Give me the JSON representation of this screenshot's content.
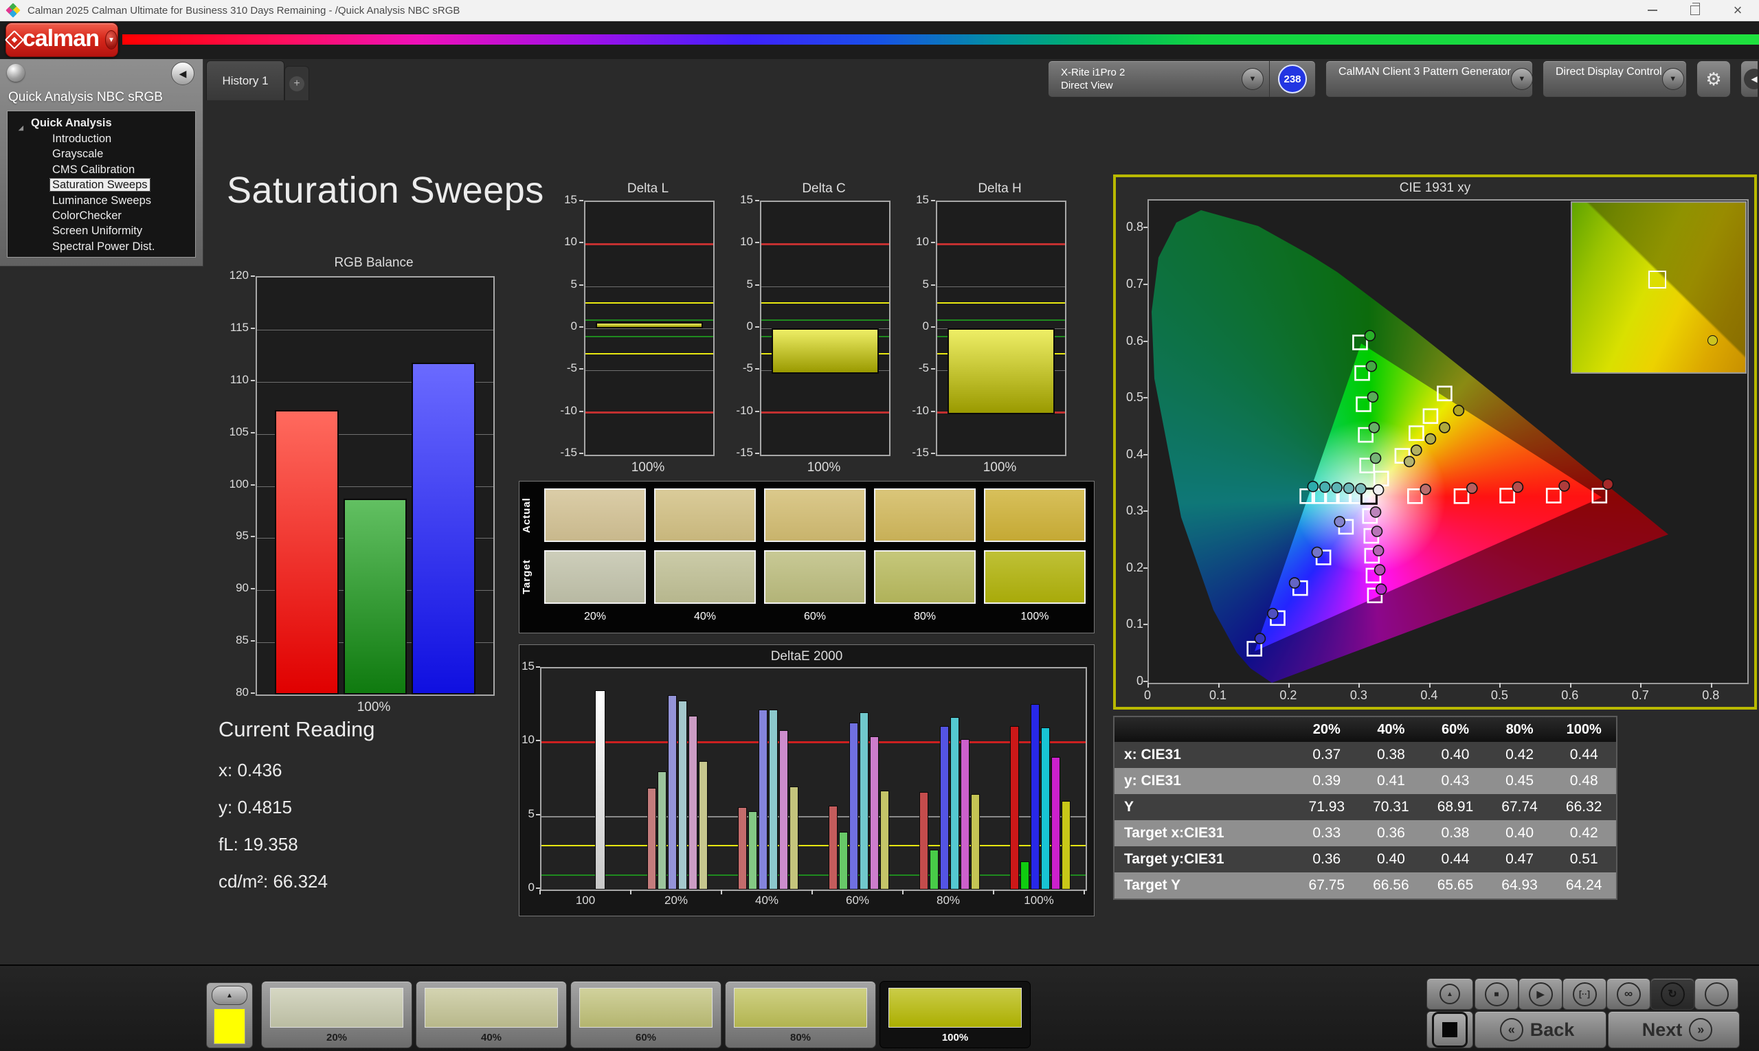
{
  "window": {
    "title": "Calman 2025 Calman Ultimate for Business 310 Days Remaining  - /Quick Analysis NBC sRGB"
  },
  "tabs": {
    "history": "History 1",
    "add": "+"
  },
  "toolbar": {
    "meter": {
      "line1": "X-Rite i1Pro 2",
      "line2": "Direct View",
      "badge": "238",
      "accent": "#27c627"
    },
    "pattern": {
      "label": "CalMAN Client 3 Pattern Generator",
      "accent": "#27c627"
    },
    "display": {
      "label": "Direct Display Control",
      "accent": "#e6e600"
    }
  },
  "header": {
    "logo_text": "calman"
  },
  "sidebar": {
    "title": "Quick Analysis NBC sRGB",
    "root": "Quick Analysis",
    "items": [
      "Introduction",
      "Grayscale",
      "CMS Calibration",
      "Saturation Sweeps",
      "Luminance Sweeps",
      "ColorChecker",
      "Screen Uniformity",
      "Spectral Power Dist."
    ],
    "selected": "Saturation Sweeps"
  },
  "page": {
    "title": "Saturation Sweeps"
  },
  "current_reading": {
    "title": "Current Reading",
    "lines": [
      {
        "label": "x",
        "value": "0.436"
      },
      {
        "label": "y",
        "value": "0.4815"
      },
      {
        "label": "fL",
        "value": "19.358"
      },
      {
        "label": "cd/m²",
        "value": "66.324"
      }
    ]
  },
  "swatches": {
    "row_labels": [
      "Actual",
      "Target"
    ],
    "column_labels": [
      "20%",
      "40%",
      "60%",
      "80%",
      "100%"
    ],
    "actual_colors": [
      "#d3c294",
      "#d2c083",
      "#d3bd72",
      "#d2b95c",
      "#cfb237"
    ],
    "target_colors": [
      "#c2c3ab",
      "#c0c095",
      "#bcbd7e",
      "#b9bb5e",
      "#b1b30a"
    ]
  },
  "table": {
    "headers": [
      "",
      "20%",
      "40%",
      "60%",
      "80%",
      "100%"
    ],
    "rows": [
      {
        "label": "x: CIE31",
        "values": [
          "0.37",
          "0.38",
          "0.40",
          "0.42",
          "0.44"
        ]
      },
      {
        "label": "y: CIE31",
        "values": [
          "0.39",
          "0.41",
          "0.43",
          "0.45",
          "0.48"
        ]
      },
      {
        "label": "Y",
        "values": [
          "71.93",
          "70.31",
          "68.91",
          "67.74",
          "66.32"
        ]
      },
      {
        "label": "Target x:CIE31",
        "values": [
          "0.33",
          "0.36",
          "0.38",
          "0.40",
          "0.42"
        ]
      },
      {
        "label": "Target y:CIE31",
        "values": [
          "0.36",
          "0.40",
          "0.44",
          "0.47",
          "0.51"
        ]
      },
      {
        "label": "Target Y",
        "values": [
          "67.75",
          "66.56",
          "65.65",
          "64.93",
          "64.24"
        ]
      }
    ]
  },
  "bottom_bar": {
    "mini_swatch_color": "#ffff00",
    "patterns": [
      {
        "label": "20%",
        "color": "#c6c8ac",
        "selected": false
      },
      {
        "label": "40%",
        "color": "#c3c393",
        "selected": false
      },
      {
        "label": "60%",
        "color": "#bfc076",
        "selected": false
      },
      {
        "label": "80%",
        "color": "#bdbf55",
        "selected": false
      },
      {
        "label": "100%",
        "color": "#b6b901",
        "selected": true
      }
    ],
    "back": "Back",
    "next": "Next"
  },
  "icons": {
    "dropdown": "▼",
    "collapse": "◀",
    "gear": "⚙",
    "add": "+",
    "expander": "◢",
    "up": "▲",
    "stop": "■",
    "play": "▶",
    "step": "[··]",
    "loop": "∞",
    "refresh": "↻",
    "back": "«",
    "next": "»",
    "close": "×"
  },
  "chart_data": [
    {
      "id": "rgb_balance",
      "type": "bar",
      "title": "RGB Balance",
      "categories": [
        "Red",
        "Green",
        "Blue"
      ],
      "values": [
        107.3,
        98.8,
        111.8
      ],
      "bar_gradients": [
        [
          "#ff6a5e",
          "#e00000"
        ],
        [
          "#62c062",
          "#0f7a0f"
        ],
        [
          "#6a6aff",
          "#0f0fe0"
        ]
      ],
      "xlabel": "100%",
      "ylabel": "",
      "ylim": [
        80,
        120
      ],
      "ytick_step": 5,
      "grid": true
    },
    {
      "id": "delta_l",
      "type": "bar",
      "title": "Delta L",
      "categories": [
        "100%"
      ],
      "values": [
        0.7
      ],
      "bar_gradient": [
        "#eeee66",
        "#9a9a00"
      ],
      "xlabel": "100%",
      "ylim": [
        -15,
        15
      ],
      "ytick_step": 5,
      "ref_lines": [
        {
          "y": 10,
          "color": "#c23030"
        },
        {
          "y": -10,
          "color": "#c23030"
        },
        {
          "y": 3,
          "color": "#e8e810"
        },
        {
          "y": -3,
          "color": "#e8e810"
        },
        {
          "y": 1,
          "color": "#1f8a1f"
        },
        {
          "y": -1,
          "color": "#1f8a1f"
        }
      ]
    },
    {
      "id": "delta_c",
      "type": "bar",
      "title": "Delta C",
      "categories": [
        "100%"
      ],
      "values": [
        -5.4
      ],
      "bar_gradient": [
        "#eeee66",
        "#9a9a00"
      ],
      "xlabel": "100%",
      "ylim": [
        -15,
        15
      ],
      "ytick_step": 5,
      "ref_lines": [
        {
          "y": 10,
          "color": "#c23030"
        },
        {
          "y": -10,
          "color": "#c23030"
        },
        {
          "y": 3,
          "color": "#e8e810"
        },
        {
          "y": -3,
          "color": "#e8e810"
        },
        {
          "y": 1,
          "color": "#1f8a1f"
        },
        {
          "y": -1,
          "color": "#1f8a1f"
        }
      ]
    },
    {
      "id": "delta_h",
      "type": "bar",
      "title": "Delta H",
      "categories": [
        "100%"
      ],
      "values": [
        -10.2
      ],
      "bar_gradient": [
        "#eeee66",
        "#9a9a00"
      ],
      "xlabel": "100%",
      "ylim": [
        -15,
        15
      ],
      "ytick_step": 5,
      "ref_lines": [
        {
          "y": 10,
          "color": "#c23030"
        },
        {
          "y": -10,
          "color": "#c23030"
        },
        {
          "y": 3,
          "color": "#e8e810"
        },
        {
          "y": -3,
          "color": "#e8e810"
        },
        {
          "y": 1,
          "color": "#1f8a1f"
        },
        {
          "y": -1,
          "color": "#1f8a1f"
        }
      ]
    },
    {
      "id": "deltae_2000",
      "type": "bar",
      "title": "DeltaE 2000",
      "group_labels": [
        "100",
        "20%",
        "40%",
        "60%",
        "80%",
        "100%"
      ],
      "groups": [
        [
          13.5
        ],
        [
          6.9,
          8.0,
          13.2,
          12.8,
          11.8,
          8.7
        ],
        [
          5.6,
          5.3,
          12.2,
          12.2,
          10.8,
          7.0
        ],
        [
          5.7,
          3.9,
          11.3,
          12.0,
          10.4,
          6.7
        ],
        [
          6.6,
          2.7,
          11.1,
          11.7,
          10.2,
          6.5
        ],
        [
          11.1,
          1.9,
          12.6,
          11.0,
          9.0,
          6.0
        ]
      ],
      "series": [
        "red",
        "green",
        "blue",
        "cyan",
        "magenta",
        "yellow"
      ],
      "white_bar_color": "#f0f0f0",
      "group_colors": [
        [
          "#c47c7c",
          "#9cc49c",
          "#9494d8",
          "#a4c8cc",
          "#cc9cc4",
          "#c6c68e"
        ],
        [
          "#c46c6c",
          "#84c884",
          "#8484dc",
          "#8cc8cc",
          "#cc8ccc",
          "#c4c47c"
        ],
        [
          "#c45c5c",
          "#68c868",
          "#7070e0",
          "#70c8cc",
          "#cc7ccc",
          "#c4c468"
        ],
        [
          "#c44c4c",
          "#48cc48",
          "#5454e4",
          "#54c8d0",
          "#cc60cc",
          "#c4c454"
        ],
        [
          "#cc1818",
          "#10cc10",
          "#2828e8",
          "#18c4d4",
          "#cc20cc",
          "#c8c818"
        ]
      ],
      "ylim": [
        0,
        15
      ],
      "yticks": [
        0,
        5,
        10,
        15
      ],
      "ref_lines": [
        {
          "y": 10,
          "color": "#cc2020"
        },
        {
          "y": 3,
          "color": "#e8e810"
        },
        {
          "y": 1,
          "color": "#1f8a1f"
        }
      ]
    },
    {
      "id": "cie_1931",
      "type": "scatter",
      "title": "CIE 1931 xy",
      "xlim": [
        0,
        0.85
      ],
      "ylim": [
        0,
        0.85
      ],
      "xticks": [
        0,
        0.1,
        0.2,
        0.3,
        0.4,
        0.5,
        0.6,
        0.7,
        0.8
      ],
      "yticks": [
        0,
        0.1,
        0.2,
        0.3,
        0.4,
        0.5,
        0.6,
        0.7,
        0.8
      ],
      "white_point_target": [
        0.3127,
        0.329
      ],
      "white_point_measured": {
        "x": 0.326,
        "y": 0.34,
        "c": "#f0f0f0"
      },
      "targets": [
        [
          0.378,
          0.329
        ],
        [
          0.444,
          0.329
        ],
        [
          0.509,
          0.33
        ],
        [
          0.575,
          0.33
        ],
        [
          0.64,
          0.33
        ],
        [
          0.31,
          0.383
        ],
        [
          0.308,
          0.437
        ],
        [
          0.305,
          0.491
        ],
        [
          0.303,
          0.546
        ],
        [
          0.3,
          0.6
        ],
        [
          0.28,
          0.275
        ],
        [
          0.248,
          0.221
        ],
        [
          0.215,
          0.167
        ],
        [
          0.183,
          0.114
        ],
        [
          0.15,
          0.06
        ],
        [
          0.295,
          0.329
        ],
        [
          0.277,
          0.329
        ],
        [
          0.26,
          0.329
        ],
        [
          0.242,
          0.329
        ],
        [
          0.225,
          0.329
        ],
        [
          0.314,
          0.294
        ],
        [
          0.316,
          0.259
        ],
        [
          0.317,
          0.224
        ],
        [
          0.319,
          0.189
        ],
        [
          0.321,
          0.154
        ],
        [
          0.33,
          0.36
        ],
        [
          0.36,
          0.4
        ],
        [
          0.38,
          0.44
        ],
        [
          0.4,
          0.47
        ],
        [
          0.42,
          0.51
        ]
      ],
      "measurements": [
        {
          "x": 0.393,
          "y": 0.341,
          "c": "#bb6e6e"
        },
        {
          "x": 0.459,
          "y": 0.343,
          "c": "#b85e5e"
        },
        {
          "x": 0.524,
          "y": 0.345,
          "c": "#b44e4e"
        },
        {
          "x": 0.59,
          "y": 0.347,
          "c": "#ae3c3c"
        },
        {
          "x": 0.652,
          "y": 0.35,
          "c": "#a62a2a"
        },
        {
          "x": 0.322,
          "y": 0.396,
          "c": "#78b478"
        },
        {
          "x": 0.32,
          "y": 0.45,
          "c": "#68b068"
        },
        {
          "x": 0.318,
          "y": 0.504,
          "c": "#58ac58"
        },
        {
          "x": 0.316,
          "y": 0.558,
          "c": "#44a844"
        },
        {
          "x": 0.314,
          "y": 0.612,
          "c": "#28b028"
        },
        {
          "x": 0.271,
          "y": 0.284,
          "c": "#8484cc"
        },
        {
          "x": 0.239,
          "y": 0.23,
          "c": "#7474c8"
        },
        {
          "x": 0.207,
          "y": 0.176,
          "c": "#6464c4"
        },
        {
          "x": 0.176,
          "y": 0.122,
          "c": "#5050c0"
        },
        {
          "x": 0.158,
          "y": 0.078,
          "c": "#3434bc"
        },
        {
          "x": 0.301,
          "y": 0.342,
          "c": "#7cbcbc"
        },
        {
          "x": 0.284,
          "y": 0.343,
          "c": "#6cb8b8"
        },
        {
          "x": 0.267,
          "y": 0.344,
          "c": "#5cb4b4"
        },
        {
          "x": 0.25,
          "y": 0.345,
          "c": "#48b0b0"
        },
        {
          "x": 0.233,
          "y": 0.346,
          "c": "#2cacac"
        },
        {
          "x": 0.322,
          "y": 0.301,
          "c": "#bc84bc"
        },
        {
          "x": 0.324,
          "y": 0.267,
          "c": "#b874b8"
        },
        {
          "x": 0.326,
          "y": 0.233,
          "c": "#b464b4"
        },
        {
          "x": 0.328,
          "y": 0.199,
          "c": "#b050b0"
        },
        {
          "x": 0.33,
          "y": 0.165,
          "c": "#b428c8"
        },
        {
          "x": 0.37,
          "y": 0.39,
          "c": "#b4b470"
        },
        {
          "x": 0.38,
          "y": 0.41,
          "c": "#b2b060"
        },
        {
          "x": 0.4,
          "y": 0.43,
          "c": "#b0ac50"
        },
        {
          "x": 0.42,
          "y": 0.45,
          "c": "#aea83c"
        },
        {
          "x": 0.44,
          "y": 0.48,
          "c": "#b0a424"
        }
      ]
    }
  ]
}
